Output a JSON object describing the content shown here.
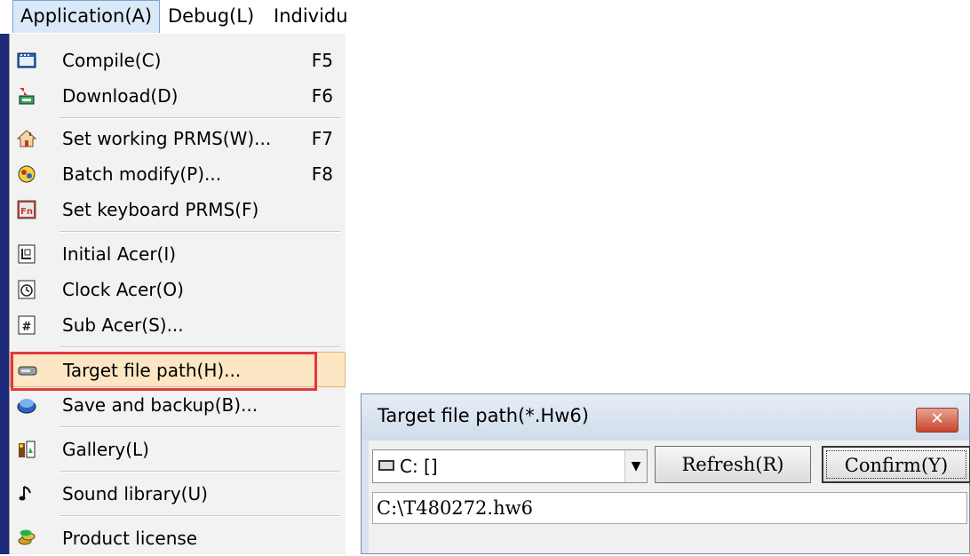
{
  "menubar": {
    "items": [
      "Application(A)",
      "Debug(L)",
      "Individu"
    ]
  },
  "menu": {
    "items": [
      {
        "label": "Compile(C)",
        "shortcut": "F5",
        "icon": "compile-icon"
      },
      {
        "label": "Download(D)",
        "shortcut": "F6",
        "icon": "download-icon"
      },
      {
        "label": "Set working PRMS(W)...",
        "shortcut": "F7",
        "icon": "home-icon"
      },
      {
        "label": "Batch modify(P)...",
        "shortcut": "F8",
        "icon": "batch-icon"
      },
      {
        "label": "Set keyboard PRMS(F)",
        "shortcut": "",
        "icon": "fn-key-icon"
      },
      {
        "label": "Initial Acer(I)",
        "shortcut": "",
        "icon": "initial-icon"
      },
      {
        "label": "Clock Acer(O)",
        "shortcut": "",
        "icon": "clock-icon"
      },
      {
        "label": "Sub Acer(S)...",
        "shortcut": "",
        "icon": "sub-icon"
      },
      {
        "label": "Target file path(H)...",
        "shortcut": "",
        "icon": "drive-icon"
      },
      {
        "label": "Save and backup(B)...",
        "shortcut": "",
        "icon": "backup-icon"
      },
      {
        "label": "Gallery(L)",
        "shortcut": "",
        "icon": "gallery-icon"
      },
      {
        "label": "Sound library(U)",
        "shortcut": "",
        "icon": "music-note-icon"
      },
      {
        "label": "Product license",
        "shortcut": "",
        "icon": "coins-icon"
      }
    ]
  },
  "dialog": {
    "title": "Target file path(*.Hw6)",
    "close_label": "✕",
    "drive_value": "C: []",
    "refresh_label": "Refresh(R)",
    "confirm_label": "Confirm(Y)",
    "path_value": "C:\\T480272.hw6"
  }
}
